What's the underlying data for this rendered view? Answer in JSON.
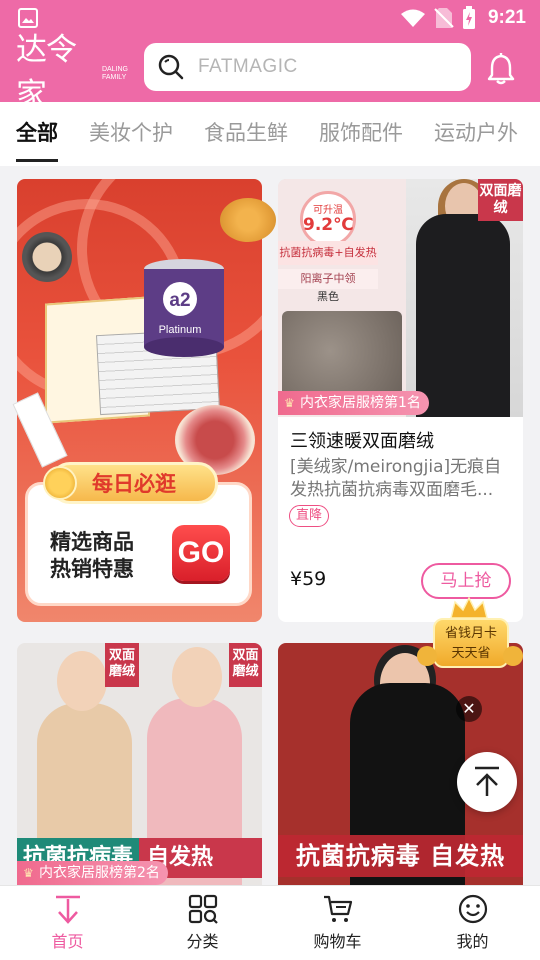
{
  "status_bar": {
    "time": "9:21"
  },
  "header": {
    "logo_text": "达令家",
    "logo_sub_line1": "DALING",
    "logo_sub_line2": "FAMILY",
    "search_placeholder": "FATMAGIC"
  },
  "tabs": [
    {
      "label": "全部",
      "active": true
    },
    {
      "label": "美妆个护",
      "active": false
    },
    {
      "label": "食品生鲜",
      "active": false
    },
    {
      "label": "服饰配件",
      "active": false
    },
    {
      "label": "运动户外",
      "active": false
    }
  ],
  "banner": {
    "ribbon": "每日必逛",
    "line1": "精选商品",
    "line2": "热销特惠",
    "go": "GO",
    "can_label": "a2",
    "can_sub": "Platinum"
  },
  "product1": {
    "img_badge_line1": "可升温",
    "img_badge_line2": "9.2℃",
    "img_strip1": "抗菌抗病毒+自发热",
    "img_strip2": "阳离子中领",
    "img_strip3": "黑色",
    "img_tag": "双面磨绒",
    "rank": "内衣家居服榜第1名",
    "title": "三领速暖双面磨绒",
    "desc": "[美绒家/meirongjia]无痕自发热抗菌抗病毒双面磨毛...",
    "tag": "直降",
    "price": "¥59",
    "buy": "马上抢"
  },
  "product2": {
    "img_tag": "双面磨绒",
    "promo1": "抗菌抗病毒",
    "promo2": "自发热",
    "rank": "内衣家居服榜第2名"
  },
  "product3": {
    "promo": "抗菌抗病毒  自发热"
  },
  "float_card": {
    "line1": "省钱月卡",
    "line2": "天天省"
  },
  "bottom_nav": [
    {
      "label": "首页",
      "icon": "home-arrow-icon",
      "active": true
    },
    {
      "label": "分类",
      "icon": "category-grid-icon",
      "active": false
    },
    {
      "label": "购物车",
      "icon": "cart-icon",
      "active": false
    },
    {
      "label": "我的",
      "icon": "smile-profile-icon",
      "active": false
    }
  ],
  "colors": {
    "brand_pink": "#ee6aa7",
    "accent_pink": "#ee5aa0"
  }
}
